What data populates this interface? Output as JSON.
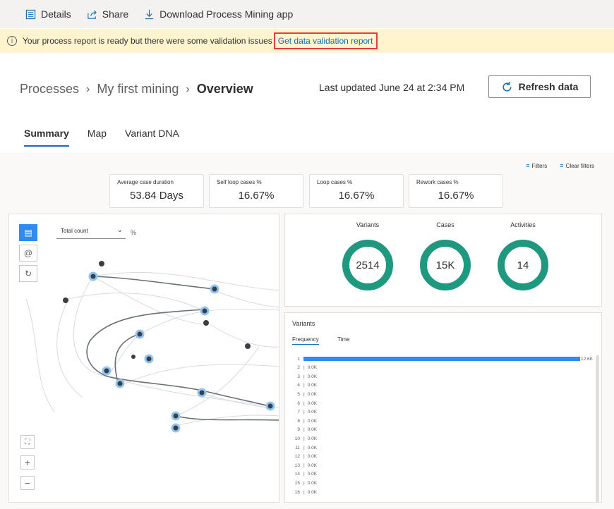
{
  "toolbar": {
    "details": "Details",
    "share": "Share",
    "download": "Download Process Mining app"
  },
  "banner": {
    "message": "Your process report is ready but there were some validation issues",
    "link": "Get data validation report"
  },
  "breadcrumb": {
    "processes": "Processes",
    "mining": "My first mining",
    "current": "Overview"
  },
  "last_updated": "Last updated June 24 at 2:34 PM",
  "refresh_label": "Refresh data",
  "tabs": [
    "Summary",
    "Map",
    "Variant DNA"
  ],
  "filters": {
    "filters": "Filters",
    "clear": "Clear filters"
  },
  "kpis": [
    {
      "label": "Average case duration",
      "value": "53.84 Days"
    },
    {
      "label": "Self loop cases %",
      "value": "16.67%"
    },
    {
      "label": "Loop cases %",
      "value": "16.67%"
    },
    {
      "label": "Rework cases %",
      "value": "16.67%"
    }
  ],
  "map": {
    "select_value": "Total count",
    "pct_label": "%"
  },
  "stats": [
    {
      "title": "Variants",
      "value": "2514"
    },
    {
      "title": "Cases",
      "value": "15K"
    },
    {
      "title": "Activities",
      "value": "14"
    }
  ],
  "variants": {
    "title": "Variants",
    "tab_frequency": "Frequency",
    "tab_time": "Time",
    "rows": [
      {
        "index": "1",
        "value": "12.6K"
      },
      {
        "index": "2",
        "value": "0.0K"
      },
      {
        "index": "3",
        "value": "0.0K"
      },
      {
        "index": "4",
        "value": "0.0K"
      },
      {
        "index": "5",
        "value": "0.0K"
      },
      {
        "index": "6",
        "value": "0.0K"
      },
      {
        "index": "7",
        "value": "0.0K"
      },
      {
        "index": "8",
        "value": "0.0K"
      },
      {
        "index": "9",
        "value": "0.0K"
      },
      {
        "index": "10",
        "value": "0.0K"
      },
      {
        "index": "11",
        "value": "0.0K"
      },
      {
        "index": "12",
        "value": "0.0K"
      },
      {
        "index": "13",
        "value": "0.0K"
      },
      {
        "index": "14",
        "value": "0.0K"
      },
      {
        "index": "15",
        "value": "0.0K"
      },
      {
        "index": "16",
        "value": "0.0K"
      }
    ]
  },
  "colors": {
    "accent": "#0f6cbd",
    "ring": "#1f9880",
    "bar": "#2e8cf0",
    "banner": "#fff4ce"
  }
}
